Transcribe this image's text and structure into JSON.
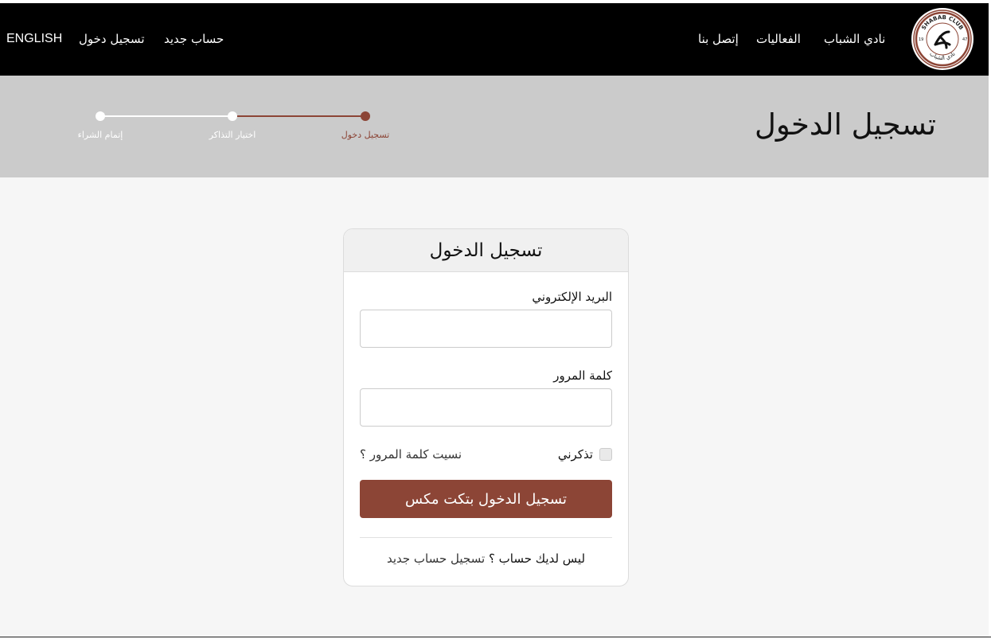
{
  "header": {
    "logo": {
      "top_text": "SHABAB CLUB",
      "bottom_text": "نادي الشباب",
      "year_left": "19",
      "year_right": "47"
    },
    "nav_right": [
      {
        "label": "نادي الشباب"
      },
      {
        "label": "الفعاليات"
      },
      {
        "label": "إتصل بنا"
      }
    ],
    "nav_left": {
      "register": "حساب جديد",
      "login": "تسجيل دخول",
      "language": "ENGLISH"
    }
  },
  "banner": {
    "title": "تسجيل الدخول",
    "steps": [
      {
        "label": "تسجيل دخول",
        "active": true
      },
      {
        "label": "اختيار التذاكر",
        "active": false
      },
      {
        "label": "إتمام الشراء",
        "active": false
      }
    ]
  },
  "login_card": {
    "title": "تسجيل الدخول",
    "email_label": "البريد الإلكتروني",
    "email_value": "",
    "password_label": "كلمة المرور",
    "password_value": "",
    "remember_label": "تذكرني",
    "remember_checked": false,
    "forgot_label": "نسيت كلمة المرور ؟",
    "submit_label": "تسجيل الدخول بتكت مكس",
    "no_account_text": "ليس لديك حساب ؟",
    "signup_link": "تسجيل حساب جديد"
  },
  "colors": {
    "header_bg": "#000000",
    "band_bg": "#cbcbcb",
    "accent": "#8c4536",
    "page_bg": "#f6f6f6"
  }
}
